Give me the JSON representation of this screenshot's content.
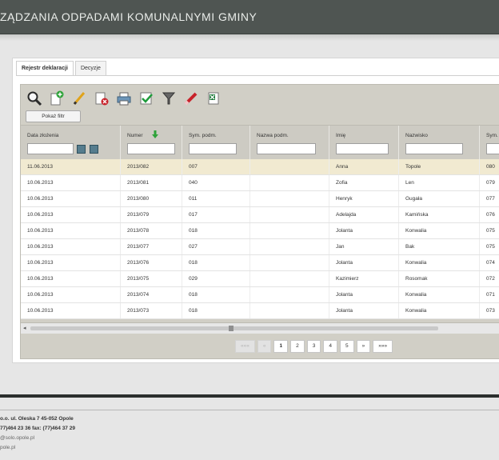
{
  "header": {
    "title": "ZĄDZANIA ODPADAMI KOMUNALNYMI GMINY"
  },
  "tabs": [
    {
      "label": "Rejestr deklaracji"
    },
    {
      "label": "Decyzje"
    }
  ],
  "toolbar": {
    "icons": [
      "search-icon",
      "add-document-icon",
      "edit-icon",
      "delete-document-icon",
      "print-icon",
      "approve-icon",
      "filter-icon",
      "eraser-icon",
      "excel-export-icon"
    ],
    "filter_button_label": "Pokaż filtr"
  },
  "columns": [
    {
      "label": "Data złożenia"
    },
    {
      "label": "Numer"
    },
    {
      "label": "Sym. podm."
    },
    {
      "label": "Nazwa podm."
    },
    {
      "label": "Imię"
    },
    {
      "label": "Nazwisko"
    },
    {
      "label": "Sym."
    }
  ],
  "rows": [
    [
      "11.06.2013",
      "2013/082",
      "007",
      "",
      "Anna",
      "Topole",
      "080"
    ],
    [
      "10.06.2013",
      "2013/081",
      "040",
      "",
      "Zofia",
      "Len",
      "079"
    ],
    [
      "10.06.2013",
      "2013/080",
      "011",
      "",
      "Henryk",
      "Gugała",
      "077"
    ],
    [
      "10.06.2013",
      "2013/079",
      "017",
      "",
      "Adelajda",
      "Kamińska",
      "076"
    ],
    [
      "10.06.2013",
      "2013/078",
      "018",
      "",
      "Jolanta",
      "Konwalia",
      "075"
    ],
    [
      "10.06.2013",
      "2013/077",
      "027",
      "",
      "Jan",
      "Bak",
      "075"
    ],
    [
      "10.06.2013",
      "2013/076",
      "018",
      "",
      "Jolanta",
      "Konwalia",
      "074"
    ],
    [
      "10.06.2013",
      "2013/075",
      "029",
      "",
      "Kazimierz",
      "Rosomak",
      "072"
    ],
    [
      "10.06.2013",
      "2013/074",
      "018",
      "",
      "Jolanta",
      "Konwalia",
      "071"
    ],
    [
      "10.06.2013",
      "2013/073",
      "018",
      "",
      "Jolanta",
      "Konwalia",
      "073"
    ]
  ],
  "selected_row": 0,
  "scrollbar": {
    "left_arrow": "◂"
  },
  "pager": {
    "first": "«««",
    "prev": "«",
    "pages": [
      "1",
      "2",
      "3",
      "4",
      "5"
    ],
    "current_page": "1",
    "next": "»",
    "last": "»»»"
  },
  "footer": {
    "line1": "o.o. ul. Oleska 7 45-052 Opole",
    "line2": "77)464 23 36 fax: (77)464 37 29",
    "line3": "@solo.opole.pl",
    "line4": "pole.pl"
  },
  "colors": {
    "header_bg": "#4f5552",
    "grid_bg": "#d1cfc6",
    "selected_row": "#f1ead1"
  }
}
